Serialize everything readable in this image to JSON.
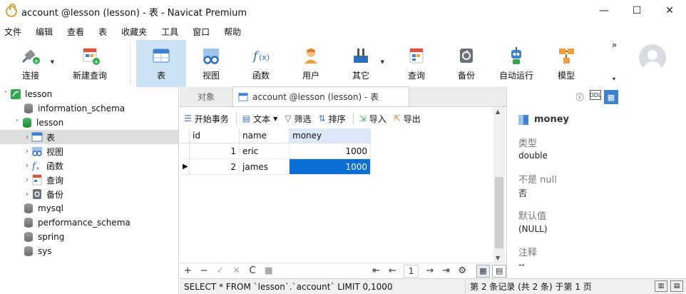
{
  "window": {
    "title": "account @lesson (lesson) - 表 - Navicat Premium",
    "minimize": "—",
    "maximize": "☐",
    "close": "✕"
  },
  "menu": [
    "文件",
    "编辑",
    "查看",
    "表",
    "收藏夹",
    "工具",
    "窗口",
    "帮助"
  ],
  "toolbar": {
    "connect": "连接",
    "new_query": "新建查询",
    "table": "表",
    "view": "视图",
    "function": "函数",
    "user": "用户",
    "other": "其它",
    "query": "查询",
    "backup": "备份",
    "autorun": "自动运行",
    "model": "模型",
    "more": "»",
    "more_caret": "▾"
  },
  "tree": {
    "connection": "lesson",
    "databases": [
      "information_schema",
      "lesson",
      "mysql",
      "performance_schema",
      "spring",
      "sys"
    ],
    "lesson_children": [
      "表",
      "视图",
      "函数",
      "查询",
      "备份"
    ]
  },
  "tabs": {
    "objects": "对象",
    "current": "account @lesson (lesson) - 表"
  },
  "subtoolbar": {
    "begin_txn": "开始事务",
    "text": "文本",
    "filter": "筛选",
    "sort": "排序",
    "import": "导入",
    "export": "导出"
  },
  "grid": {
    "columns": [
      "id",
      "name",
      "money"
    ],
    "rows": [
      {
        "id": "1",
        "name": "eric",
        "money": "1000"
      },
      {
        "id": "2",
        "name": "james",
        "money": "1000"
      }
    ]
  },
  "navbar": {
    "add": "+",
    "remove": "−",
    "apply": "✓",
    "discard": "✕",
    "refresh": "C",
    "stop": "■",
    "first": "⇤",
    "prev": "←",
    "page": "1",
    "next": "→",
    "last": "⇥",
    "settings": "⚙"
  },
  "status": {
    "sql": "SELECT * FROM `lesson`.`account` LIMIT 0,1000",
    "records": "第 2 条记录 (共 2 条) 于第 1 页"
  },
  "right_panel": {
    "field_name": "money",
    "type_label": "类型",
    "type_value": "double",
    "notnull_label": "不是 null",
    "notnull_value": "否",
    "default_label": "默认值",
    "default_value": "(NULL)",
    "comment_label": "注释",
    "comment_value": "--"
  },
  "colors": {
    "accent": "#0c6fd6",
    "toolbar_active": "#cde3f5",
    "tree_selected": "#dedede"
  }
}
